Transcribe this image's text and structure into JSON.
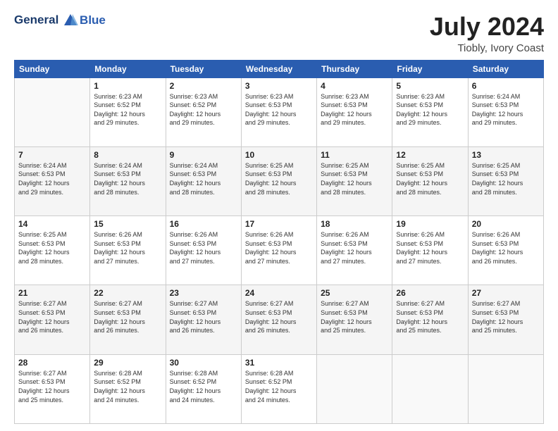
{
  "header": {
    "logo_line1": "General",
    "logo_line2": "Blue",
    "month_year": "July 2024",
    "location": "Tiobly, Ivory Coast"
  },
  "days_of_week": [
    "Sunday",
    "Monday",
    "Tuesday",
    "Wednesday",
    "Thursday",
    "Friday",
    "Saturday"
  ],
  "weeks": [
    [
      {
        "day": "",
        "info": ""
      },
      {
        "day": "1",
        "info": "Sunrise: 6:23 AM\nSunset: 6:52 PM\nDaylight: 12 hours\nand 29 minutes."
      },
      {
        "day": "2",
        "info": "Sunrise: 6:23 AM\nSunset: 6:52 PM\nDaylight: 12 hours\nand 29 minutes."
      },
      {
        "day": "3",
        "info": "Sunrise: 6:23 AM\nSunset: 6:53 PM\nDaylight: 12 hours\nand 29 minutes."
      },
      {
        "day": "4",
        "info": "Sunrise: 6:23 AM\nSunset: 6:53 PM\nDaylight: 12 hours\nand 29 minutes."
      },
      {
        "day": "5",
        "info": "Sunrise: 6:23 AM\nSunset: 6:53 PM\nDaylight: 12 hours\nand 29 minutes."
      },
      {
        "day": "6",
        "info": "Sunrise: 6:24 AM\nSunset: 6:53 PM\nDaylight: 12 hours\nand 29 minutes."
      }
    ],
    [
      {
        "day": "7",
        "info": "Sunrise: 6:24 AM\nSunset: 6:53 PM\nDaylight: 12 hours\nand 29 minutes."
      },
      {
        "day": "8",
        "info": "Sunrise: 6:24 AM\nSunset: 6:53 PM\nDaylight: 12 hours\nand 28 minutes."
      },
      {
        "day": "9",
        "info": "Sunrise: 6:24 AM\nSunset: 6:53 PM\nDaylight: 12 hours\nand 28 minutes."
      },
      {
        "day": "10",
        "info": "Sunrise: 6:25 AM\nSunset: 6:53 PM\nDaylight: 12 hours\nand 28 minutes."
      },
      {
        "day": "11",
        "info": "Sunrise: 6:25 AM\nSunset: 6:53 PM\nDaylight: 12 hours\nand 28 minutes."
      },
      {
        "day": "12",
        "info": "Sunrise: 6:25 AM\nSunset: 6:53 PM\nDaylight: 12 hours\nand 28 minutes."
      },
      {
        "day": "13",
        "info": "Sunrise: 6:25 AM\nSunset: 6:53 PM\nDaylight: 12 hours\nand 28 minutes."
      }
    ],
    [
      {
        "day": "14",
        "info": "Sunrise: 6:25 AM\nSunset: 6:53 PM\nDaylight: 12 hours\nand 28 minutes."
      },
      {
        "day": "15",
        "info": "Sunrise: 6:26 AM\nSunset: 6:53 PM\nDaylight: 12 hours\nand 27 minutes."
      },
      {
        "day": "16",
        "info": "Sunrise: 6:26 AM\nSunset: 6:53 PM\nDaylight: 12 hours\nand 27 minutes."
      },
      {
        "day": "17",
        "info": "Sunrise: 6:26 AM\nSunset: 6:53 PM\nDaylight: 12 hours\nand 27 minutes."
      },
      {
        "day": "18",
        "info": "Sunrise: 6:26 AM\nSunset: 6:53 PM\nDaylight: 12 hours\nand 27 minutes."
      },
      {
        "day": "19",
        "info": "Sunrise: 6:26 AM\nSunset: 6:53 PM\nDaylight: 12 hours\nand 27 minutes."
      },
      {
        "day": "20",
        "info": "Sunrise: 6:26 AM\nSunset: 6:53 PM\nDaylight: 12 hours\nand 26 minutes."
      }
    ],
    [
      {
        "day": "21",
        "info": "Sunrise: 6:27 AM\nSunset: 6:53 PM\nDaylight: 12 hours\nand 26 minutes."
      },
      {
        "day": "22",
        "info": "Sunrise: 6:27 AM\nSunset: 6:53 PM\nDaylight: 12 hours\nand 26 minutes."
      },
      {
        "day": "23",
        "info": "Sunrise: 6:27 AM\nSunset: 6:53 PM\nDaylight: 12 hours\nand 26 minutes."
      },
      {
        "day": "24",
        "info": "Sunrise: 6:27 AM\nSunset: 6:53 PM\nDaylight: 12 hours\nand 26 minutes."
      },
      {
        "day": "25",
        "info": "Sunrise: 6:27 AM\nSunset: 6:53 PM\nDaylight: 12 hours\nand 25 minutes."
      },
      {
        "day": "26",
        "info": "Sunrise: 6:27 AM\nSunset: 6:53 PM\nDaylight: 12 hours\nand 25 minutes."
      },
      {
        "day": "27",
        "info": "Sunrise: 6:27 AM\nSunset: 6:53 PM\nDaylight: 12 hours\nand 25 minutes."
      }
    ],
    [
      {
        "day": "28",
        "info": "Sunrise: 6:27 AM\nSunset: 6:53 PM\nDaylight: 12 hours\nand 25 minutes."
      },
      {
        "day": "29",
        "info": "Sunrise: 6:28 AM\nSunset: 6:52 PM\nDaylight: 12 hours\nand 24 minutes."
      },
      {
        "day": "30",
        "info": "Sunrise: 6:28 AM\nSunset: 6:52 PM\nDaylight: 12 hours\nand 24 minutes."
      },
      {
        "day": "31",
        "info": "Sunrise: 6:28 AM\nSunset: 6:52 PM\nDaylight: 12 hours\nand 24 minutes."
      },
      {
        "day": "",
        "info": ""
      },
      {
        "day": "",
        "info": ""
      },
      {
        "day": "",
        "info": ""
      }
    ]
  ]
}
